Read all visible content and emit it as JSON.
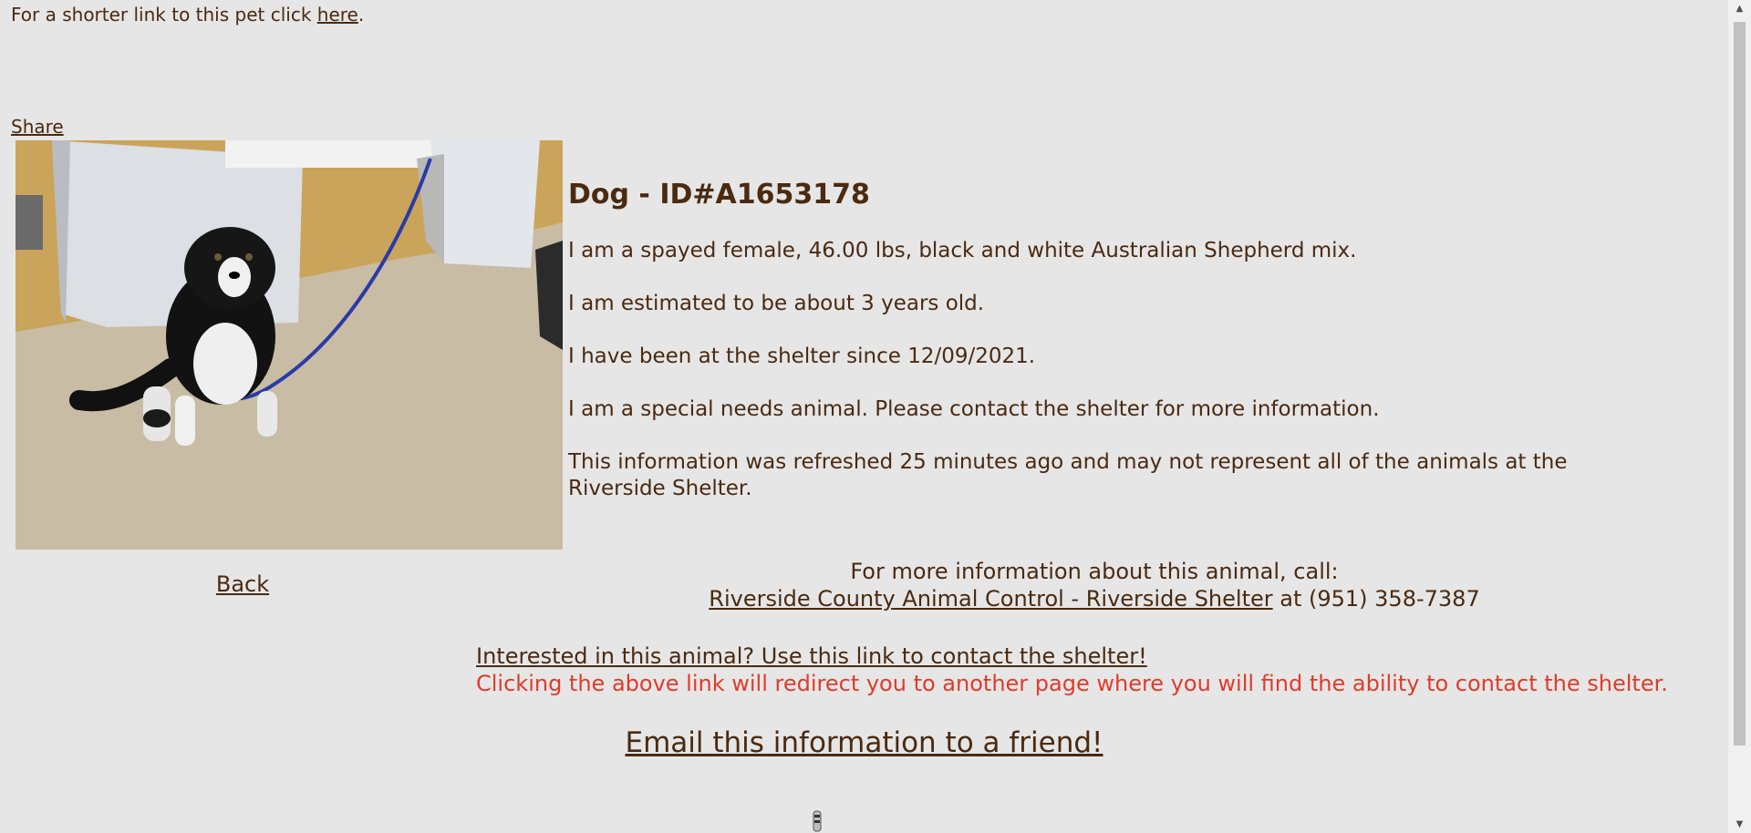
{
  "header": {
    "short_link_prefix": "For a shorter link to this pet click ",
    "short_link_label": "here",
    "short_link_suffix": ".",
    "share_label": "Share"
  },
  "photo": {
    "alt": "Dog A1653178 photo"
  },
  "back_label": "Back",
  "animal": {
    "title": "Dog - ID#A1653178",
    "description": "I am a spayed female, 46.00 lbs, black and white Australian Shepherd mix.",
    "age": "I am estimated to be about 3 years old.",
    "since": "I have been at the shelter since 12/09/2021.",
    "special_needs": "I am a special needs animal. Please contact the shelter for more information.",
    "refresh_note": "This information was refreshed 25 minutes ago and may not represent all of the animals at the Riverside Shelter."
  },
  "contact": {
    "call_text": "For more information about this animal, call:",
    "shelter_link": "Riverside County Animal Control - Riverside Shelter",
    "phone_text": " at (951) 358-7387",
    "interest_link": "Interested in this animal? Use this link to contact the shelter!",
    "redirect_note": "Clicking the above link will redirect you to another page where you will find the ability to contact the shelter."
  },
  "email_label": "Email this information to a friend!",
  "colors": {
    "background": "#e6e6e6",
    "text": "#4a2a10",
    "warning": "#e03b2a"
  }
}
